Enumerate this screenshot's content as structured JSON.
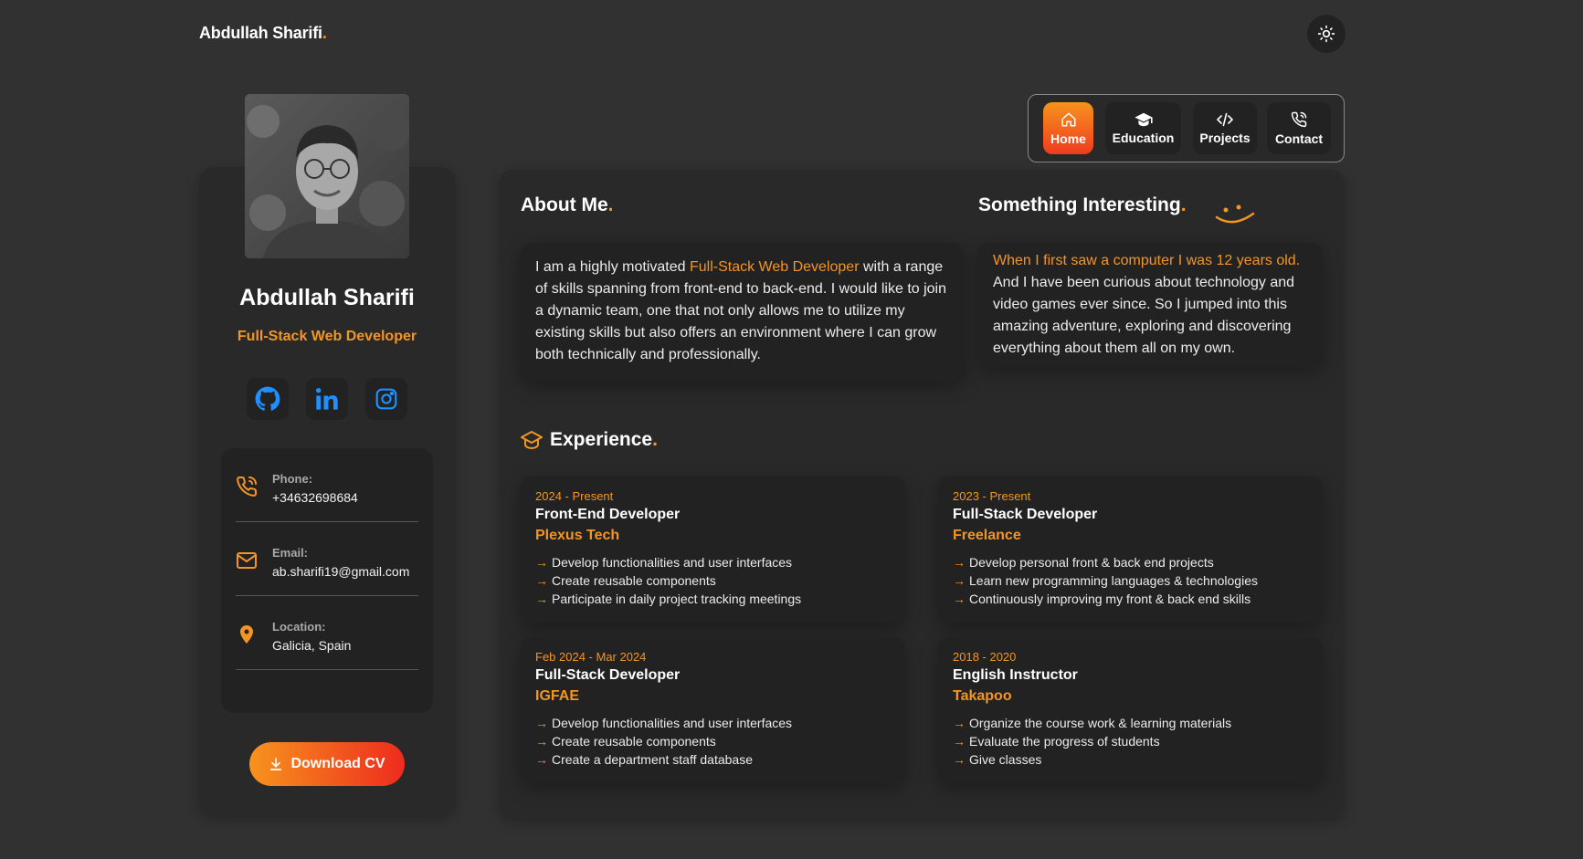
{
  "header": {
    "brand_name": "Abdullah Sharifi",
    "brand_dot": ".",
    "theme_icon": "sun-icon"
  },
  "profile": {
    "name": "Abdullah Sharifi",
    "role": "Full-Stack Web Developer",
    "socials": [
      {
        "icon": "github-icon"
      },
      {
        "icon": "linkedin-icon"
      },
      {
        "icon": "instagram-icon"
      }
    ],
    "contacts": [
      {
        "label": "Phone:",
        "value": "+34632698684",
        "icon": "phone-icon"
      },
      {
        "label": "Email:",
        "value": "ab.sharifi19@gmail.com",
        "icon": "mail-icon"
      },
      {
        "label": "Location:",
        "value": "Galicia, Spain",
        "icon": "location-pin-icon"
      }
    ],
    "download_label": "Download CV"
  },
  "nav": {
    "items": [
      {
        "label": "Home",
        "icon": "home-icon",
        "active": true
      },
      {
        "label": "Education",
        "icon": "graduation-cap-icon",
        "active": false
      },
      {
        "label": "Projects",
        "icon": "code-icon",
        "active": false
      },
      {
        "label": "Contact",
        "icon": "phone-call-icon",
        "active": false
      }
    ]
  },
  "about": {
    "title": "About Me",
    "dot": ".",
    "text_before": "I am a highly motivated ",
    "highlight": "Full-Stack Web Developer",
    "text_after": " with a range of skills spanning from front-end to back-end. I would like to join a dynamic team, one that not only allows me to utilize my existing skills but also offers an environment where I can grow both technically and professionally."
  },
  "interesting": {
    "title": "Something Interesting",
    "dot": ".",
    "highlight": "When I first saw a computer I was 12 years old.",
    "text": " And I have been curious about technology and video games ever since. So I jumped into this amazing adventure, exploring and discovering everything about them all on my own."
  },
  "experience": {
    "title": "Experience",
    "dot": ".",
    "items": [
      {
        "date": "2024 - Present",
        "title": "Front-End Developer",
        "company": "Plexus Tech",
        "points": [
          "Develop functionalities and user interfaces",
          "Create reusable components",
          "Participate in daily project tracking meetings"
        ]
      },
      {
        "date": "2023 - Present",
        "title": "Full-Stack Developer",
        "company": "Freelance",
        "points": [
          "Develop personal front & back end projects",
          "Learn new programming languages & technologies",
          "Continuously improving my front & back end skills"
        ]
      },
      {
        "date": "Feb 2024 - Mar 2024",
        "title": "Full-Stack Developer",
        "company": "IGFAE",
        "points": [
          "Develop functionalities and user interfaces",
          "Create reusable components",
          "Create a department staff database"
        ]
      },
      {
        "date": "2018 - 2020",
        "title": "English Instructor",
        "company": "Takapoo",
        "points": [
          "Organize the course work & learning materials",
          "Evaluate the progress of students",
          "Give classes"
        ]
      }
    ]
  },
  "colors": {
    "accent": "#f39523",
    "background": "#313131",
    "card": "#292929",
    "inner": "#222222"
  }
}
